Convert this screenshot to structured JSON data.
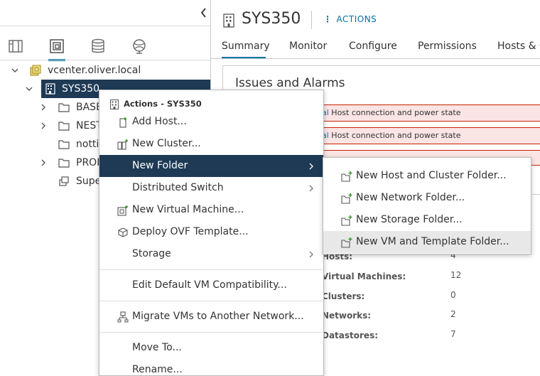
{
  "navigator": {
    "tree": [
      {
        "label": "vcenter.oliver.local",
        "icon": "vcenter-icon",
        "expanded": true
      },
      {
        "label": "SYS350",
        "icon": "datacenter-icon",
        "expanded": true,
        "selected": true
      },
      {
        "label": "BASE",
        "icon": "folder-icon"
      },
      {
        "label": "NEST",
        "icon": "folder-icon"
      },
      {
        "label": "nottic",
        "icon": "folder-icon"
      },
      {
        "label": "PROI",
        "icon": "folder-icon"
      },
      {
        "label": "Supe",
        "icon": "host-icon"
      }
    ],
    "tabs": [
      "hosts-clusters-icon",
      "vms-templates-icon",
      "storage-icon",
      "networking-icon"
    ]
  },
  "object": {
    "title": "SYS350",
    "actions_label": "ACTIONS",
    "tabs": [
      "Summary",
      "Monitor",
      "Configure",
      "Permissions",
      "Hosts & C"
    ]
  },
  "issues": {
    "title": "Issues and Alarms",
    "alarms": [
      {
        "prefix": "al",
        "text": "Host connection and power state"
      },
      {
        "prefix": "al",
        "text": "Host connection and power state"
      }
    ]
  },
  "stats": [
    {
      "label": "Hosts:",
      "value": "4"
    },
    {
      "label": "Virtual Machines:",
      "value": "12"
    },
    {
      "label": "Clusters:",
      "value": "0"
    },
    {
      "label": "Networks:",
      "value": "2"
    },
    {
      "label": "Datastores:",
      "value": "7"
    }
  ],
  "context_menu": {
    "header": "Actions - SYS350",
    "items": [
      {
        "label": "Add Host...",
        "icon": "add-host-icon"
      },
      {
        "label": "New Cluster...",
        "icon": "new-cluster-icon"
      },
      {
        "label": "New Folder",
        "submenu": true,
        "highlighted": true
      },
      {
        "label": "Distributed Switch",
        "submenu": true
      },
      {
        "label": "New Virtual Machine...",
        "icon": "new-vm-icon"
      },
      {
        "label": "Deploy OVF Template...",
        "icon": "deploy-ovf-icon"
      },
      {
        "label": "Storage",
        "submenu": true
      },
      {
        "label": "Edit Default VM Compatibility..."
      },
      {
        "label": "Migrate VMs to Another Network...",
        "icon": "migrate-icon"
      },
      {
        "label": "Move To..."
      },
      {
        "label": "Rename..."
      }
    ]
  },
  "submenu": {
    "items": [
      {
        "label": "New Host and Cluster Folder..."
      },
      {
        "label": "New Network Folder..."
      },
      {
        "label": "New Storage Folder..."
      },
      {
        "label": "New VM and Template Folder...",
        "highlighted": true
      }
    ]
  },
  "colors": {
    "accent": "#0072a3",
    "selection": "#1e3a55",
    "alarm_bg": "#fae4e4",
    "alarm_border": "#c92100",
    "folder_plus": "#3c9a2f"
  }
}
